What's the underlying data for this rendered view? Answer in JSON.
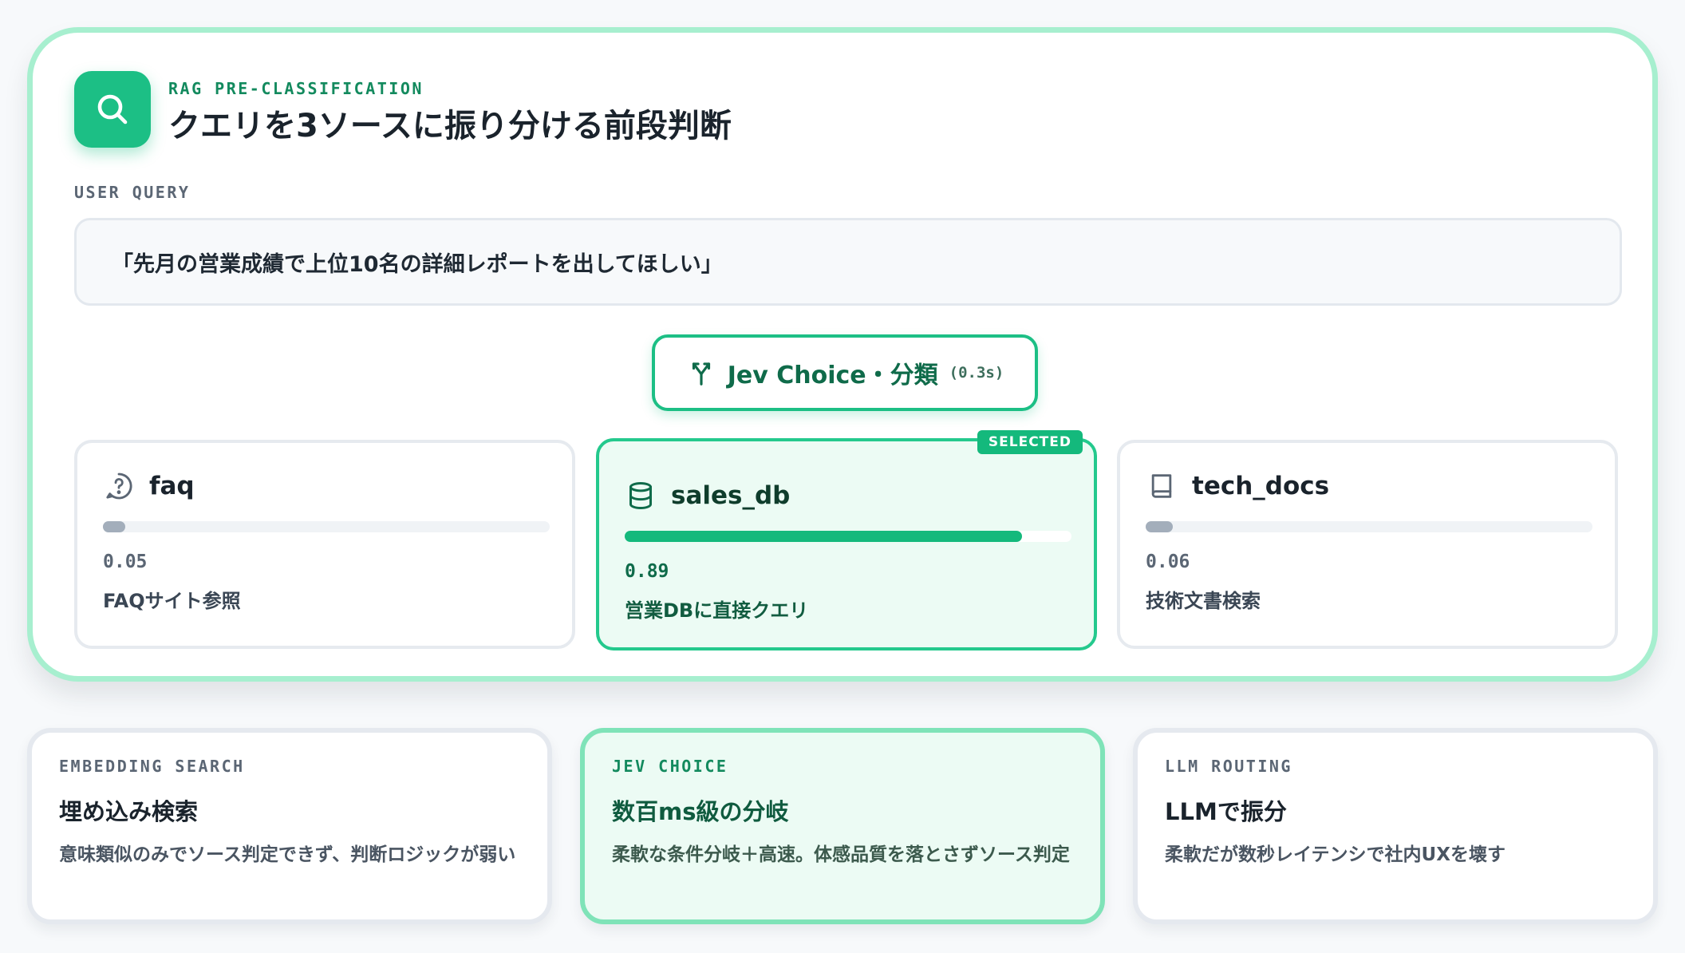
{
  "header": {
    "kicker": "RAG PRE-CLASSIFICATION",
    "title": "クエリを3ソースに振り分ける前段判断",
    "icon": "search-icon"
  },
  "query": {
    "caption": "USER QUERY",
    "text": "「先月の営業成績で上位10名の詳細レポートを出してほしい」"
  },
  "classifier": {
    "label": "Jev Choice・分類",
    "time": "(0.3s)",
    "icon": "split-arrows-icon"
  },
  "routes": [
    {
      "name": "faq",
      "icon": "help-circle-icon",
      "score": "0.05",
      "score_value": 0.05,
      "desc": "FAQサイト参照",
      "selected": false
    },
    {
      "name": "sales_db",
      "icon": "database-icon",
      "score": "0.89",
      "score_value": 0.89,
      "desc": "営業DBに直接クエリ",
      "selected": true,
      "badge": "SELECTED"
    },
    {
      "name": "tech_docs",
      "icon": "book-icon",
      "score": "0.06",
      "score_value": 0.06,
      "desc": "技術文書検索",
      "selected": false
    }
  ],
  "comparison": [
    {
      "kicker": "EMBEDDING SEARCH",
      "title": "埋め込み検索",
      "body": "意味類似のみでソース判定できず、判断ロジックが弱い"
    },
    {
      "kicker": "JEV CHOICE",
      "title": "数百ms級の分岐",
      "body": "柔軟な条件分岐＋高速。体感品質を落とさずソース判定"
    },
    {
      "kicker": "LLM ROUTING",
      "title": "LLMで振分",
      "body": "柔軟だが数秒レイテンシで社内UXを壊す"
    }
  ],
  "colors": {
    "accent": "#1cbf85",
    "accent_dark": "#0f6b4a",
    "panel_border": "#a7efcf",
    "selected_bg": "#ecfbf4",
    "muted_bar": "#a3aebb"
  }
}
